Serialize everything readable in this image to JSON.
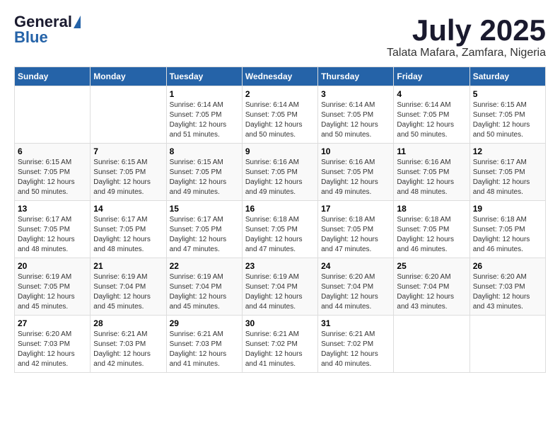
{
  "logo": {
    "general": "General",
    "blue": "Blue"
  },
  "header": {
    "month_year": "July 2025",
    "location": "Talata Mafara, Zamfara, Nigeria"
  },
  "weekdays": [
    "Sunday",
    "Monday",
    "Tuesday",
    "Wednesday",
    "Thursday",
    "Friday",
    "Saturday"
  ],
  "weeks": [
    [
      {
        "day": "",
        "sunrise": "",
        "sunset": "",
        "daylight": ""
      },
      {
        "day": "",
        "sunrise": "",
        "sunset": "",
        "daylight": ""
      },
      {
        "day": "1",
        "sunrise": "Sunrise: 6:14 AM",
        "sunset": "Sunset: 7:05 PM",
        "daylight": "Daylight: 12 hours and 51 minutes."
      },
      {
        "day": "2",
        "sunrise": "Sunrise: 6:14 AM",
        "sunset": "Sunset: 7:05 PM",
        "daylight": "Daylight: 12 hours and 50 minutes."
      },
      {
        "day": "3",
        "sunrise": "Sunrise: 6:14 AM",
        "sunset": "Sunset: 7:05 PM",
        "daylight": "Daylight: 12 hours and 50 minutes."
      },
      {
        "day": "4",
        "sunrise": "Sunrise: 6:14 AM",
        "sunset": "Sunset: 7:05 PM",
        "daylight": "Daylight: 12 hours and 50 minutes."
      },
      {
        "day": "5",
        "sunrise": "Sunrise: 6:15 AM",
        "sunset": "Sunset: 7:05 PM",
        "daylight": "Daylight: 12 hours and 50 minutes."
      }
    ],
    [
      {
        "day": "6",
        "sunrise": "Sunrise: 6:15 AM",
        "sunset": "Sunset: 7:05 PM",
        "daylight": "Daylight: 12 hours and 50 minutes."
      },
      {
        "day": "7",
        "sunrise": "Sunrise: 6:15 AM",
        "sunset": "Sunset: 7:05 PM",
        "daylight": "Daylight: 12 hours and 49 minutes."
      },
      {
        "day": "8",
        "sunrise": "Sunrise: 6:15 AM",
        "sunset": "Sunset: 7:05 PM",
        "daylight": "Daylight: 12 hours and 49 minutes."
      },
      {
        "day": "9",
        "sunrise": "Sunrise: 6:16 AM",
        "sunset": "Sunset: 7:05 PM",
        "daylight": "Daylight: 12 hours and 49 minutes."
      },
      {
        "day": "10",
        "sunrise": "Sunrise: 6:16 AM",
        "sunset": "Sunset: 7:05 PM",
        "daylight": "Daylight: 12 hours and 49 minutes."
      },
      {
        "day": "11",
        "sunrise": "Sunrise: 6:16 AM",
        "sunset": "Sunset: 7:05 PM",
        "daylight": "Daylight: 12 hours and 48 minutes."
      },
      {
        "day": "12",
        "sunrise": "Sunrise: 6:17 AM",
        "sunset": "Sunset: 7:05 PM",
        "daylight": "Daylight: 12 hours and 48 minutes."
      }
    ],
    [
      {
        "day": "13",
        "sunrise": "Sunrise: 6:17 AM",
        "sunset": "Sunset: 7:05 PM",
        "daylight": "Daylight: 12 hours and 48 minutes."
      },
      {
        "day": "14",
        "sunrise": "Sunrise: 6:17 AM",
        "sunset": "Sunset: 7:05 PM",
        "daylight": "Daylight: 12 hours and 48 minutes."
      },
      {
        "day": "15",
        "sunrise": "Sunrise: 6:17 AM",
        "sunset": "Sunset: 7:05 PM",
        "daylight": "Daylight: 12 hours and 47 minutes."
      },
      {
        "day": "16",
        "sunrise": "Sunrise: 6:18 AM",
        "sunset": "Sunset: 7:05 PM",
        "daylight": "Daylight: 12 hours and 47 minutes."
      },
      {
        "day": "17",
        "sunrise": "Sunrise: 6:18 AM",
        "sunset": "Sunset: 7:05 PM",
        "daylight": "Daylight: 12 hours and 47 minutes."
      },
      {
        "day": "18",
        "sunrise": "Sunrise: 6:18 AM",
        "sunset": "Sunset: 7:05 PM",
        "daylight": "Daylight: 12 hours and 46 minutes."
      },
      {
        "day": "19",
        "sunrise": "Sunrise: 6:18 AM",
        "sunset": "Sunset: 7:05 PM",
        "daylight": "Daylight: 12 hours and 46 minutes."
      }
    ],
    [
      {
        "day": "20",
        "sunrise": "Sunrise: 6:19 AM",
        "sunset": "Sunset: 7:05 PM",
        "daylight": "Daylight: 12 hours and 45 minutes."
      },
      {
        "day": "21",
        "sunrise": "Sunrise: 6:19 AM",
        "sunset": "Sunset: 7:04 PM",
        "daylight": "Daylight: 12 hours and 45 minutes."
      },
      {
        "day": "22",
        "sunrise": "Sunrise: 6:19 AM",
        "sunset": "Sunset: 7:04 PM",
        "daylight": "Daylight: 12 hours and 45 minutes."
      },
      {
        "day": "23",
        "sunrise": "Sunrise: 6:19 AM",
        "sunset": "Sunset: 7:04 PM",
        "daylight": "Daylight: 12 hours and 44 minutes."
      },
      {
        "day": "24",
        "sunrise": "Sunrise: 6:20 AM",
        "sunset": "Sunset: 7:04 PM",
        "daylight": "Daylight: 12 hours and 44 minutes."
      },
      {
        "day": "25",
        "sunrise": "Sunrise: 6:20 AM",
        "sunset": "Sunset: 7:04 PM",
        "daylight": "Daylight: 12 hours and 43 minutes."
      },
      {
        "day": "26",
        "sunrise": "Sunrise: 6:20 AM",
        "sunset": "Sunset: 7:03 PM",
        "daylight": "Daylight: 12 hours and 43 minutes."
      }
    ],
    [
      {
        "day": "27",
        "sunrise": "Sunrise: 6:20 AM",
        "sunset": "Sunset: 7:03 PM",
        "daylight": "Daylight: 12 hours and 42 minutes."
      },
      {
        "day": "28",
        "sunrise": "Sunrise: 6:21 AM",
        "sunset": "Sunset: 7:03 PM",
        "daylight": "Daylight: 12 hours and 42 minutes."
      },
      {
        "day": "29",
        "sunrise": "Sunrise: 6:21 AM",
        "sunset": "Sunset: 7:03 PM",
        "daylight": "Daylight: 12 hours and 41 minutes."
      },
      {
        "day": "30",
        "sunrise": "Sunrise: 6:21 AM",
        "sunset": "Sunset: 7:02 PM",
        "daylight": "Daylight: 12 hours and 41 minutes."
      },
      {
        "day": "31",
        "sunrise": "Sunrise: 6:21 AM",
        "sunset": "Sunset: 7:02 PM",
        "daylight": "Daylight: 12 hours and 40 minutes."
      },
      {
        "day": "",
        "sunrise": "",
        "sunset": "",
        "daylight": ""
      },
      {
        "day": "",
        "sunrise": "",
        "sunset": "",
        "daylight": ""
      }
    ]
  ]
}
